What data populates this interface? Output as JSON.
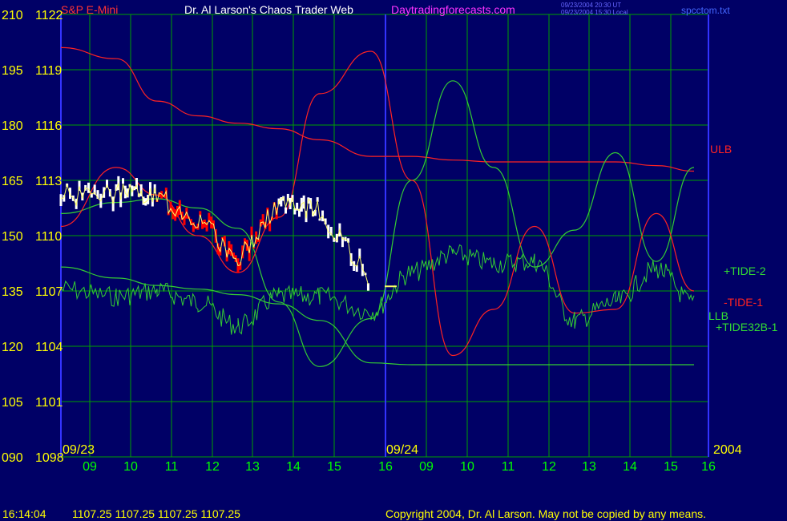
{
  "header": {
    "instrument": "S&P E-Mini",
    "site_title": "Dr. Al Larson's Chaos Trader Web",
    "site_url": "Daytradingforecasts.com",
    "timestamp_ut": "09/23/2004 20:30 UT",
    "timestamp_local": "09/23/2004 15:30 Local",
    "filename": "spcctom.txt"
  },
  "footer": {
    "time": "16:14:04",
    "quote": "1107.25 1107.25 1107.25 1107.25",
    "copyright": "Copyright 2004, Dr. Al Larson. May not be copied by any means."
  },
  "axes": {
    "left_ticks": [
      "210",
      "195",
      "180",
      "165",
      "150",
      "135",
      "120",
      "105",
      "090"
    ],
    "price_ticks": [
      "1122",
      "1119",
      "1116",
      "1113",
      "1110",
      "1107",
      "1104",
      "1101",
      "1098"
    ],
    "hour_ticks": [
      "09",
      "10",
      "11",
      "12",
      "13",
      "14",
      "15",
      "16",
      "09",
      "10",
      "11",
      "12",
      "13",
      "14",
      "15",
      "16"
    ],
    "date_labels": [
      "09/23",
      "09/24"
    ],
    "year_label": "2004"
  },
  "legend": {
    "ulb": "ULB",
    "tide2": "+TIDE-2",
    "tide1": "-TIDE-1",
    "llb": "LLB",
    "tide32": "+TIDE32B-1"
  },
  "colors": {
    "background": "#000066",
    "grid": "#00a000",
    "green_line": "#33cc33",
    "red_line": "#ff2222",
    "price_white": "#ffffff",
    "price_red": "#ff0000",
    "moving_avg": "#ffff66",
    "blue_line": "#3333ff",
    "axis_yellow": "#ffff00",
    "tick_green": "#00ff00",
    "title_magenta": "#ff33ff"
  },
  "chart_data": {
    "type": "line",
    "title": "S&P E-Mini",
    "x": [
      "09/23 09",
      "09/23 10",
      "09/23 11",
      "09/23 12",
      "09/23 13",
      "09/23 14",
      "09/23 15",
      "09/23 16",
      "09/24 09",
      "09/24 10",
      "09/24 11",
      "09/24 12",
      "09/24 13",
      "09/24 14",
      "09/24 15",
      "09/24 16"
    ],
    "ylim_left": [
      90,
      210
    ],
    "ylim_price": [
      1098,
      1122
    ],
    "grid": true,
    "series": [
      {
        "name": "ULB",
        "color": "red",
        "values": [
          1120.2,
          1119.6,
          1117.3,
          1116.5,
          1116.1,
          1115.8,
          1115.2,
          1114.3,
          1114.3,
          1114.1,
          1114.0,
          1114.0,
          1114.0,
          1114.0,
          1113.8,
          1113.5
        ]
      },
      {
        "name": "LLB",
        "color": "green",
        "values": [
          1108.3,
          1107.7,
          1107.3,
          1107.1,
          1106.8,
          1106.3,
          1105.4,
          1103.1,
          1103.0,
          1103.0,
          1103.0,
          1103.0,
          1103.0,
          1103.0,
          1103.0,
          1103.0
        ]
      },
      {
        "name": "+TIDE-2",
        "color": "green",
        "values": [
          1111.2,
          1111.8,
          1112.0,
          1111.5,
          1110.4,
          1106.4,
          1102.9,
          1105.5,
          1113.0,
          1118.4,
          1113.7,
          1108.3,
          1110.3,
          1114.5,
          1108.6,
          1113.7
        ]
      },
      {
        "name": "-TIDE-1",
        "color": "red",
        "values": [
          1110.5,
          1113.7,
          1112.2,
          1110.0,
          1108.0,
          1111.0,
          1117.7,
          1120.0,
          1113.0,
          1103.5,
          1106.0,
          1110.5,
          1105.8,
          1106.0,
          1111.2,
          1107.0
        ]
      },
      {
        "name": "+TIDE32B-1",
        "color": "green",
        "values": [
          1107.1,
          1106.7,
          1107.0,
          1106.4,
          1105.1,
          1106.7,
          1106.7,
          1105.9,
          1108.0,
          1109.0,
          1108.5,
          1108.6,
          1105.4,
          1106.4,
          1108.2,
          1106.3
        ]
      },
      {
        "name": "Price",
        "color": "white/red",
        "values": [
          1112.2,
          1112.3,
          1112.1,
          1110.9,
          1108.7,
          1111.8,
          1111.3,
          1107.6
        ]
      }
    ]
  }
}
